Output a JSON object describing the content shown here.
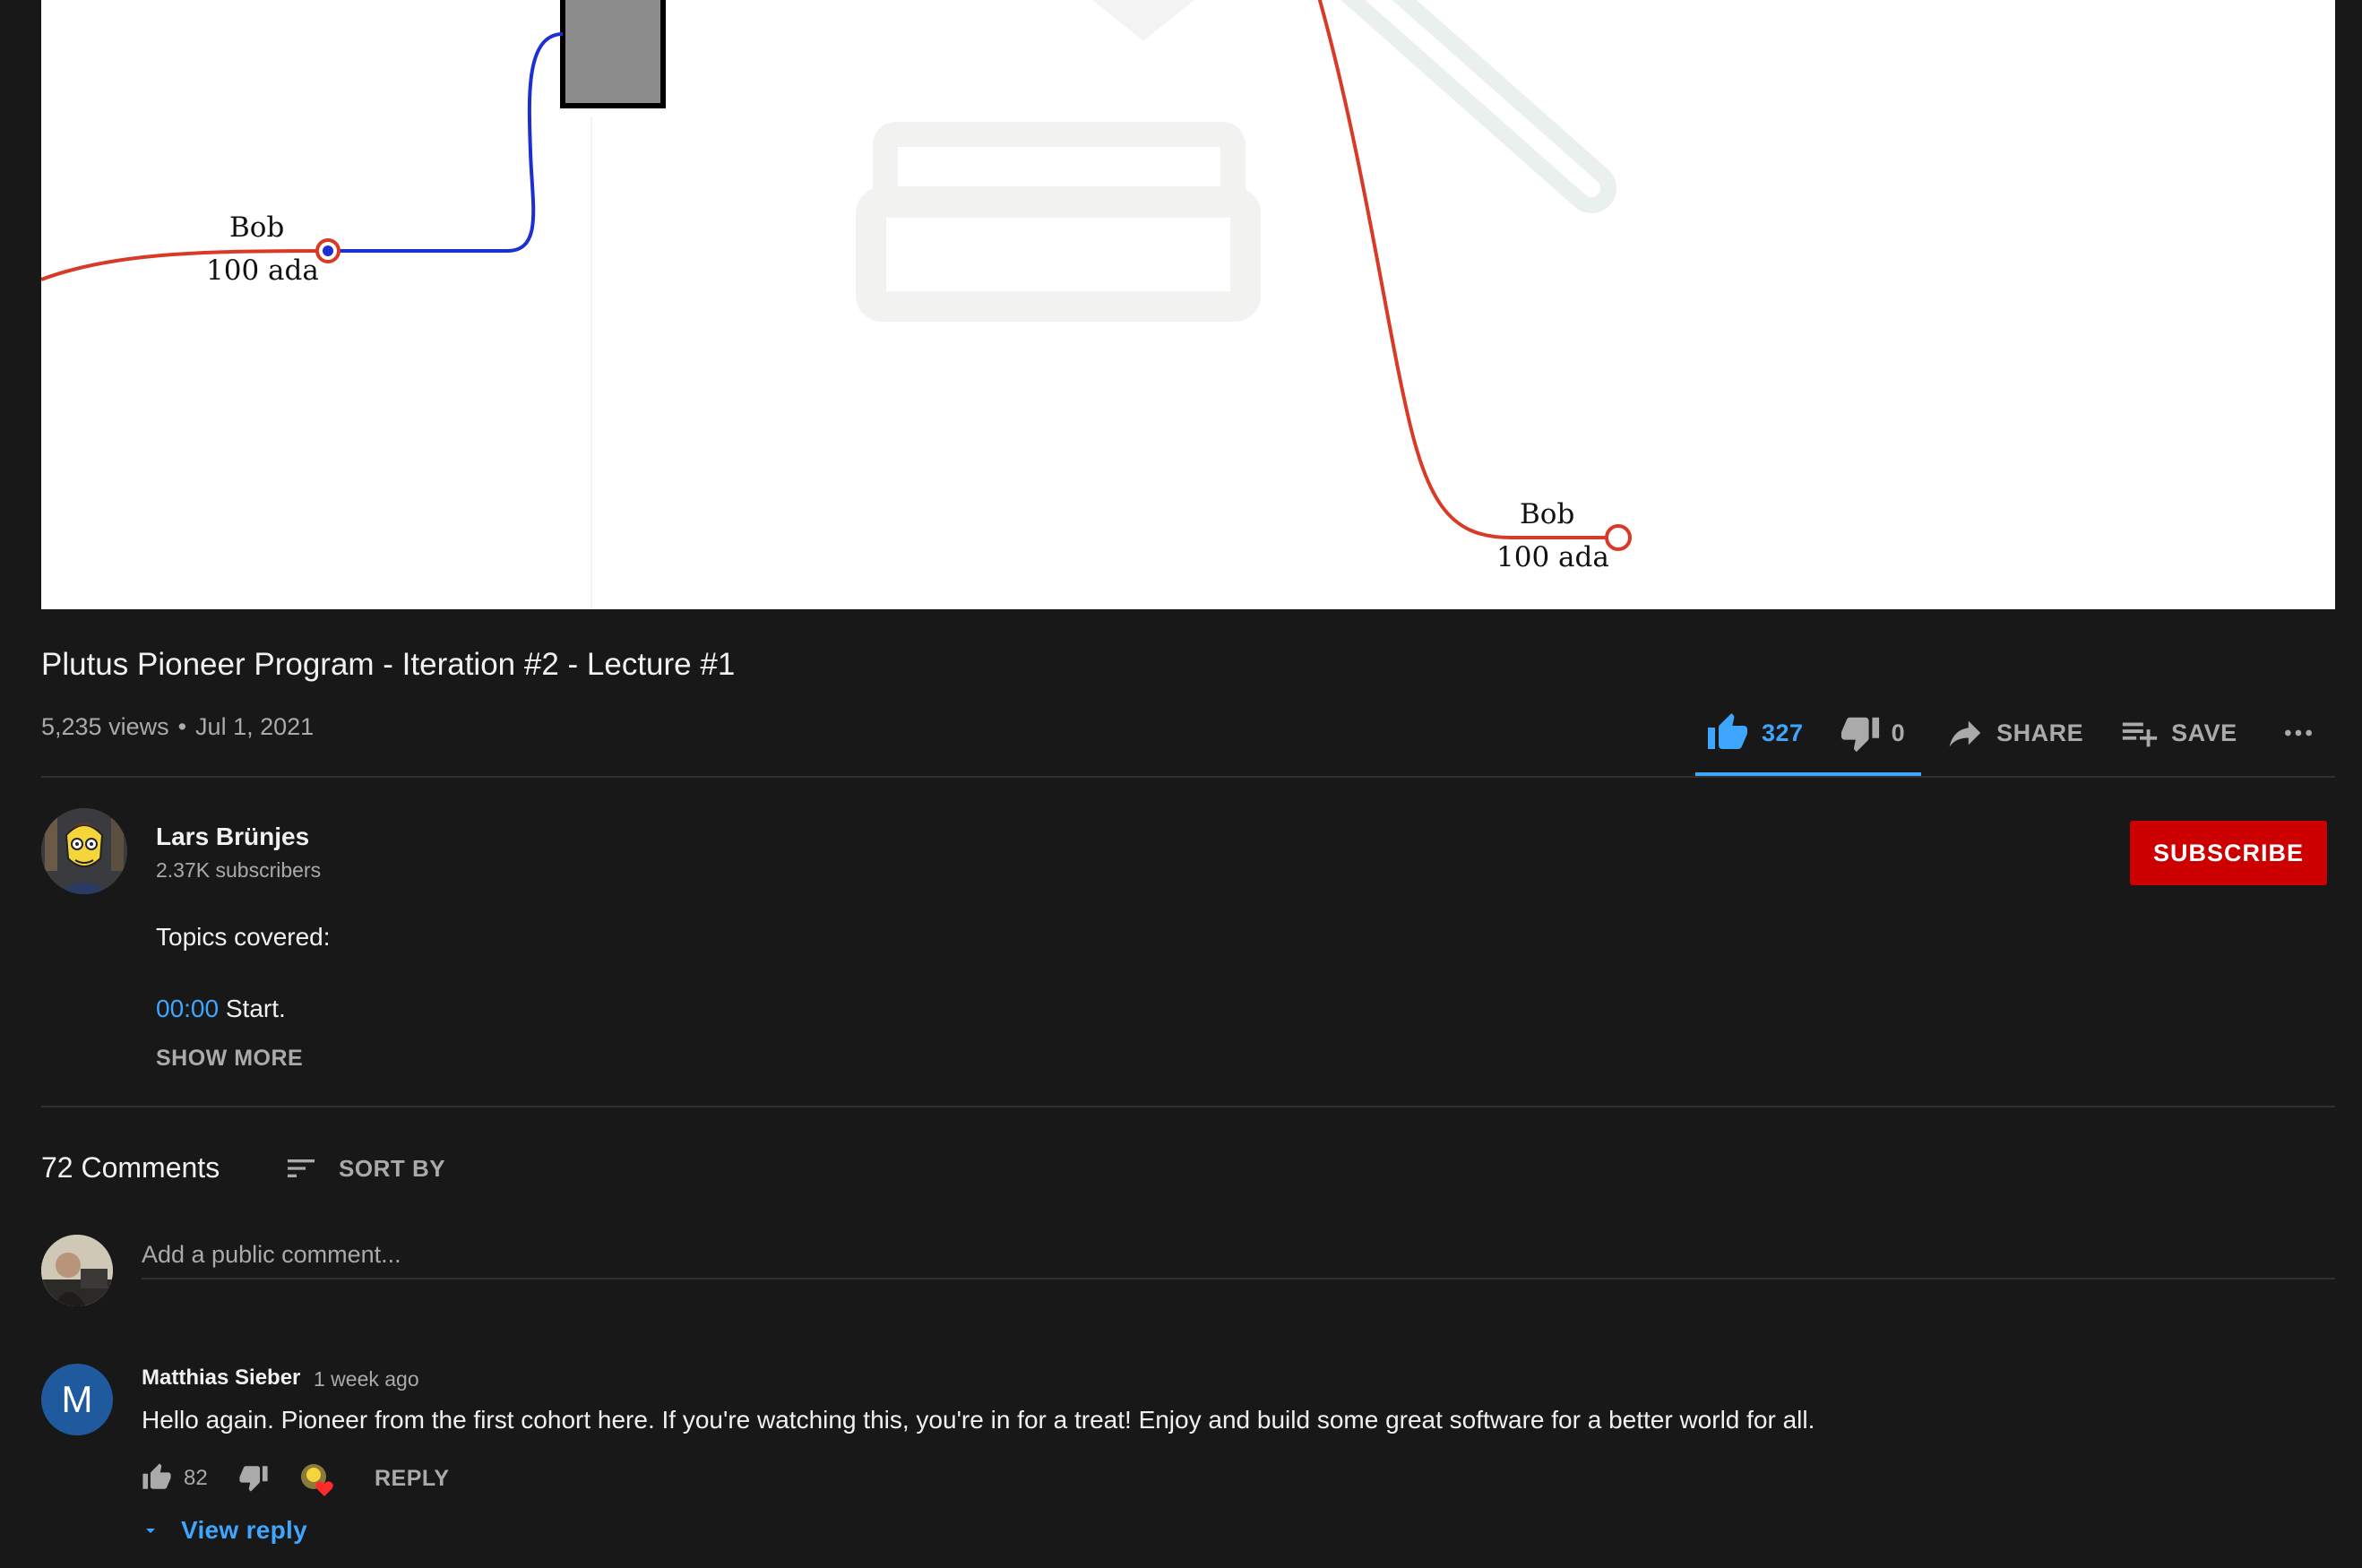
{
  "video": {
    "label_left_name": "Bob",
    "label_left_amount": "100 ada",
    "label_right_name": "Bob",
    "label_right_amount": "100 ada"
  },
  "title": "Plutus Pioneer Program - Iteration #2 - Lecture #1",
  "meta": {
    "views": "5,235 views",
    "separator": "•",
    "date": "Jul 1, 2021"
  },
  "actions": {
    "likes": "327",
    "dislikes": "0",
    "share_label": "SHARE",
    "save_label": "SAVE"
  },
  "channel": {
    "name": "Lars Brünjes",
    "subscribers": "2.37K subscribers",
    "subscribe_label": "SUBSCRIBE"
  },
  "description": {
    "heading": "Topics covered:",
    "timestamp": "00:00",
    "line_text": " Start.",
    "show_more": "SHOW MORE"
  },
  "comments": {
    "count_label": "72 Comments",
    "sort_label": "SORT BY",
    "input_placeholder": "Add a public comment...",
    "items": [
      {
        "avatar_letter": "M",
        "author": "Matthias Sieber",
        "time": "1 week ago",
        "text": "Hello again. Pioneer from the first cohort here. If you're watching this, you're in for a treat! Enjoy and build some great software for a better world for all.",
        "likes": "82",
        "reply_label": "REPLY",
        "view_reply_label": "View reply"
      }
    ]
  },
  "colors": {
    "background": "#181818",
    "accent_blue": "#3ea6ff",
    "subscribe_red": "#cc0000",
    "muted_text": "#aaaaaa",
    "line_red": "#d93a26",
    "line_blue": "#1c2fd1"
  },
  "icons": [
    "thumb-up-icon",
    "thumb-down-icon",
    "share-arrow-icon",
    "playlist-add-icon",
    "more-horiz-icon",
    "sort-icon",
    "caret-down-icon",
    "creator-heart-icon"
  ]
}
